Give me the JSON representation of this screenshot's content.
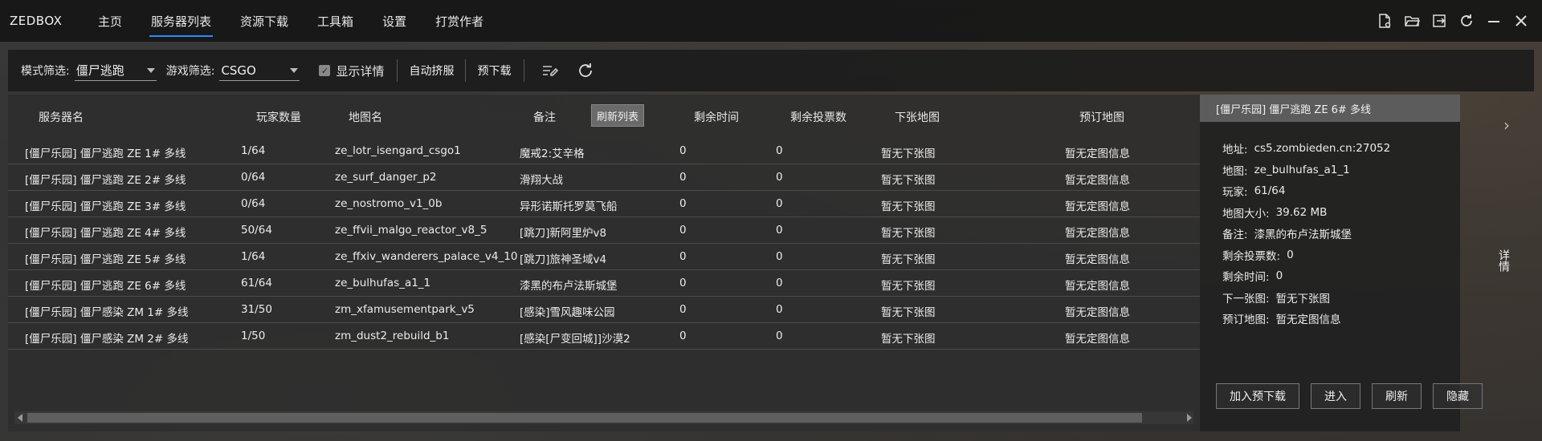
{
  "app": {
    "title": "ZEDBOX",
    "nav": [
      {
        "label": "主页"
      },
      {
        "label": "服务器列表"
      },
      {
        "label": "资源下载"
      },
      {
        "label": "工具箱"
      },
      {
        "label": "设置"
      },
      {
        "label": "打赏作者"
      }
    ],
    "active_nav": "服务器列表",
    "accent": "#2f8cff",
    "window_icons": [
      "file-settings-icon",
      "folder-open-icon",
      "exit-icon",
      "refresh-icon",
      "minimize-icon",
      "close-icon"
    ]
  },
  "toolbar": {
    "mode_label": "模式筛选:",
    "mode_value": "僵尸逃跑",
    "game_label": "游戏筛选:",
    "game_value": "CSGO",
    "show_details_label": "显示详情",
    "show_details_checked": true,
    "auto_squeeze_label": "自动挤服",
    "pre_download_label": "预下载"
  },
  "table": {
    "headers": {
      "server_name": "服务器名",
      "players": "玩家数量",
      "map": "地图名",
      "note": "备注",
      "refresh": "刷新列表",
      "time_left": "剩余时间",
      "votes_left": "剩余投票数",
      "next_map": "下张地图",
      "reserved_map": "预订地图"
    },
    "rows": [
      {
        "name": "[僵尸乐园] 僵尸逃跑 ZE 1# 多线",
        "players": "1/64",
        "map": "ze_lotr_isengard_csgo1",
        "note": "魔戒2:艾辛格",
        "time": "0",
        "votes": "0",
        "next": "暂无下张图",
        "reserved": "暂无定图信息"
      },
      {
        "name": "[僵尸乐园] 僵尸逃跑 ZE 2# 多线",
        "players": "0/64",
        "map": "ze_surf_danger_p2",
        "note": "滑翔大战",
        "time": "0",
        "votes": "0",
        "next": "暂无下张图",
        "reserved": "暂无定图信息"
      },
      {
        "name": "[僵尸乐园] 僵尸逃跑 ZE 3# 多线",
        "players": "0/64",
        "map": "ze_nostromo_v1_0b",
        "note": "异形诺斯托罗莫飞船",
        "time": "0",
        "votes": "0",
        "next": "暂无下张图",
        "reserved": "暂无定图信息"
      },
      {
        "name": "[僵尸乐园] 僵尸逃跑 ZE 4# 多线",
        "players": "50/64",
        "map": "ze_ffvii_malgo_reactor_v8_5",
        "note": "[跳刀]新阿里炉v8",
        "time": "0",
        "votes": "0",
        "next": "暂无下张图",
        "reserved": "暂无定图信息"
      },
      {
        "name": "[僵尸乐园] 僵尸逃跑 ZE 5# 多线",
        "players": "1/64",
        "map": "ze_ffxiv_wanderers_palace_v4_10",
        "note": "[跳刀]旅神圣域v4",
        "time": "0",
        "votes": "0",
        "next": "暂无下张图",
        "reserved": "暂无定图信息"
      },
      {
        "name": "[僵尸乐园] 僵尸逃跑 ZE 6# 多线",
        "players": "61/64",
        "map": "ze_bulhufas_a1_1",
        "note": "漆黑的布卢法斯城堡",
        "time": "0",
        "votes": "0",
        "next": "暂无下张图",
        "reserved": "暂无定图信息"
      },
      {
        "name": "[僵尸乐园] 僵尸感染 ZM 1# 多线",
        "players": "31/50",
        "map": "zm_xfamusementpark_v5",
        "note": "[感染]雪风趣味公园",
        "time": "0",
        "votes": "0",
        "next": "暂无下张图",
        "reserved": "暂无定图信息"
      },
      {
        "name": "[僵尸乐园] 僵尸感染 ZM 2# 多线",
        "players": "1/50",
        "map": "zm_dust2_rebuild_b1",
        "note": "[感染[尸变回城]]沙漠2",
        "time": "0",
        "votes": "0",
        "next": "暂无下张图",
        "reserved": "暂无定图信息"
      }
    ]
  },
  "detail": {
    "header": "[僵尸乐园] 僵尸逃跑 ZE 6# 多线",
    "lines": [
      {
        "k": "地址:",
        "v": "cs5.zombieden.cn:27052"
      },
      {
        "k": "地图:",
        "v": "ze_bulhufas_a1_1"
      },
      {
        "k": "玩家:",
        "v": "61/64"
      },
      {
        "k": "地图大小:",
        "v": "39.62 MB"
      },
      {
        "k": "备注:",
        "v": "漆黑的布卢法斯城堡"
      },
      {
        "k": "剩余投票数:",
        "v": "0"
      },
      {
        "k": "剩余时间:",
        "v": "0"
      },
      {
        "k": "下一张图:",
        "v": "暂无下张图"
      },
      {
        "k": "预订地图:",
        "v": "暂无定图信息"
      }
    ],
    "buttons": {
      "add_pre_download": "加入预下载",
      "enter": "进入",
      "refresh": "刷新",
      "hide": "隐藏"
    },
    "side_tab": "详情"
  }
}
